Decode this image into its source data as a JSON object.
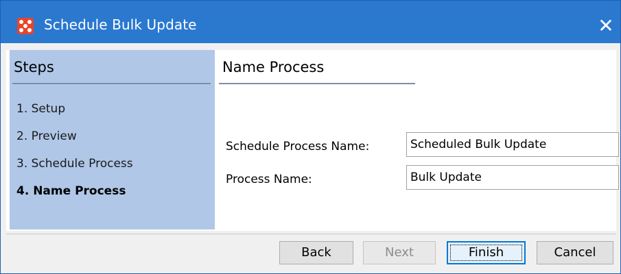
{
  "window": {
    "title": "Schedule Bulk Update",
    "icon": "app-grid-icon",
    "close_glyph": "✕"
  },
  "steps": {
    "title": "Steps",
    "items": [
      {
        "label": "1. Setup",
        "active": false
      },
      {
        "label": "2. Preview",
        "active": false
      },
      {
        "label": "3. Schedule Process",
        "active": false
      },
      {
        "label": "4. Name Process",
        "active": true
      }
    ]
  },
  "content": {
    "title": "Name Process",
    "fields": [
      {
        "label": "Schedule Process Name:",
        "value": "Scheduled Bulk Update"
      },
      {
        "label": "Process Name:",
        "value": "Bulk Update"
      }
    ]
  },
  "buttons": {
    "back": "Back",
    "next": "Next",
    "finish": "Finish",
    "cancel": "Cancel"
  },
  "colors": {
    "titlebar": "#2b78cf",
    "steps_panel": "#b0c7e8",
    "app_icon": "#e8452b"
  }
}
